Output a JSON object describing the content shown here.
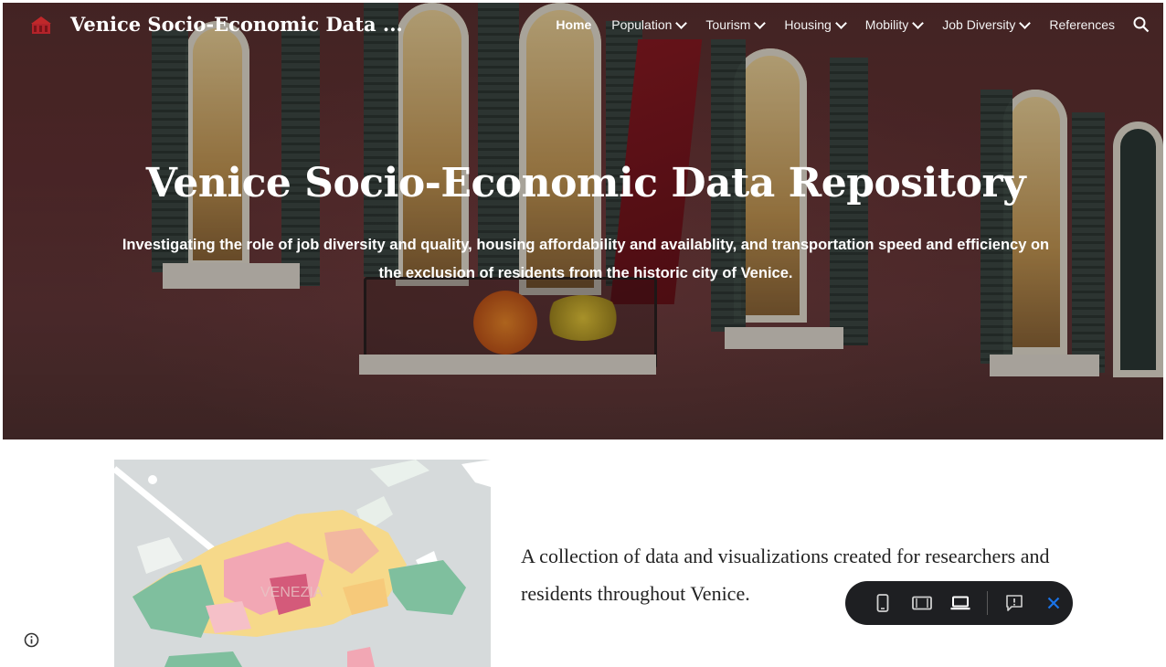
{
  "site": {
    "title": "Venice Socio-Economic Data ..."
  },
  "nav": {
    "items": [
      {
        "label": "Home",
        "dropdown": false,
        "active": true
      },
      {
        "label": "Population",
        "dropdown": true
      },
      {
        "label": "Tourism",
        "dropdown": true
      },
      {
        "label": "Housing",
        "dropdown": true
      },
      {
        "label": "Mobility",
        "dropdown": true
      },
      {
        "label": "Job Diversity",
        "dropdown": true
      },
      {
        "label": "References",
        "dropdown": false
      }
    ],
    "search_icon": "search-icon"
  },
  "hero": {
    "title": "Venice Socio-Economic Data Repository",
    "subtitle": "Investigating the role of job diversity and quality, housing affordability and availablity, and transportation speed and efficiency on the exclusion of residents from the historic city of Venice."
  },
  "intro": {
    "text": "A collection of data and visualizations created for researchers and residents throughout Venice."
  },
  "map": {
    "label": "VENEZIA"
  },
  "toolbar": {
    "icons": [
      "phone-preview-icon",
      "tablet-preview-icon",
      "laptop-preview-icon",
      "report-abuse-icon",
      "close-icon"
    ]
  },
  "colors": {
    "map_water": "#d6dadb",
    "map_green": "#7fbf9e",
    "map_pink": "#f2a7b4",
    "map_yellow": "#f6d98a",
    "toolbar_bg": "#1e1f22",
    "close_blue": "#1a73e8"
  }
}
